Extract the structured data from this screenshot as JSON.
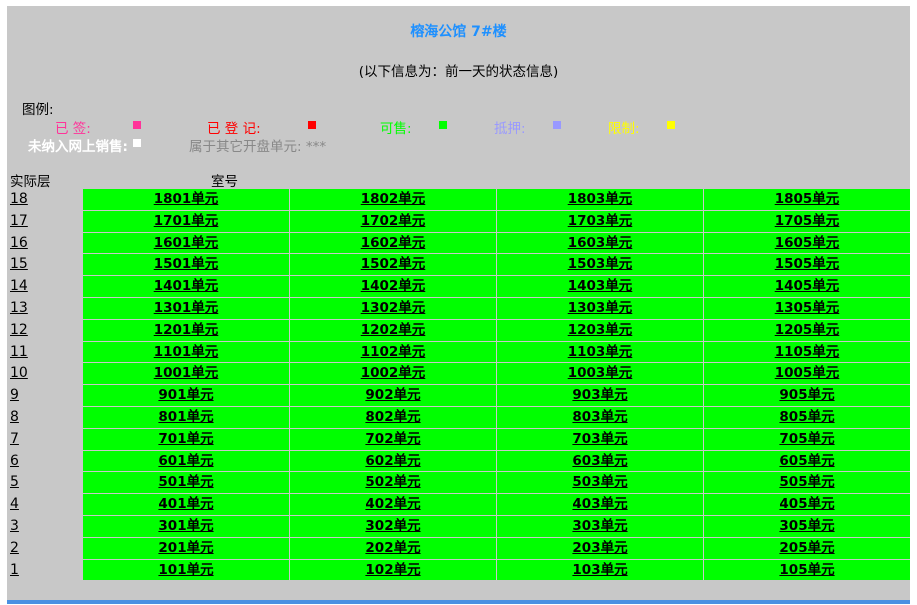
{
  "header": {
    "title": "榕海公馆  7#楼",
    "subtitle": "(以下信息为：前一天的状态信息)"
  },
  "legend": {
    "label": "图例:",
    "items": [
      {
        "label": "已  签:",
        "color": "#ff3399"
      },
      {
        "label": "已  登  记:",
        "color": "#ff0000"
      },
      {
        "label": "可售:",
        "color": "#00ff00"
      },
      {
        "label": "抵押:",
        "color": "#9999ff"
      },
      {
        "label": "限制:",
        "color": "#ffff00"
      },
      {
        "label": "未纳入网上销售:",
        "color": "#ffffff"
      }
    ],
    "other_units": "属于其它开盘单元: ***"
  },
  "table": {
    "floor_header": "实际层",
    "room_header": "室号",
    "rows": [
      {
        "floor": "18",
        "units": [
          "1801单元",
          "1802单元",
          "1803单元",
          "1805单元"
        ]
      },
      {
        "floor": "17",
        "units": [
          "1701单元",
          "1702单元",
          "1703单元",
          "1705单元"
        ]
      },
      {
        "floor": "16",
        "units": [
          "1601单元",
          "1602单元",
          "1603单元",
          "1605单元"
        ]
      },
      {
        "floor": "15",
        "units": [
          "1501单元",
          "1502单元",
          "1503单元",
          "1505单元"
        ]
      },
      {
        "floor": "14",
        "units": [
          "1401单元",
          "1402单元",
          "1403单元",
          "1405单元"
        ]
      },
      {
        "floor": "13",
        "units": [
          "1301单元",
          "1302单元",
          "1303单元",
          "1305单元"
        ]
      },
      {
        "floor": "12",
        "units": [
          "1201单元",
          "1202单元",
          "1203单元",
          "1205单元"
        ]
      },
      {
        "floor": "11",
        "units": [
          "1101单元",
          "1102单元",
          "1103单元",
          "1105单元"
        ]
      },
      {
        "floor": "10",
        "units": [
          "1001单元",
          "1002单元",
          "1003单元",
          "1005单元"
        ]
      },
      {
        "floor": "9",
        "units": [
          "901单元",
          "902单元",
          "903单元",
          "905单元"
        ]
      },
      {
        "floor": "8",
        "units": [
          "801单元",
          "802单元",
          "803单元",
          "805单元"
        ]
      },
      {
        "floor": "7",
        "units": [
          "701单元",
          "702单元",
          "703单元",
          "705单元"
        ]
      },
      {
        "floor": "6",
        "units": [
          "601单元",
          "602单元",
          "603单元",
          "605单元"
        ]
      },
      {
        "floor": "5",
        "units": [
          "501单元",
          "502单元",
          "503单元",
          "505单元"
        ]
      },
      {
        "floor": "4",
        "units": [
          "401单元",
          "402单元",
          "403单元",
          "405单元"
        ]
      },
      {
        "floor": "3",
        "units": [
          "301单元",
          "302单元",
          "303单元",
          "305单元"
        ]
      },
      {
        "floor": "2",
        "units": [
          "201单元",
          "202单元",
          "203单元",
          "205单元"
        ]
      },
      {
        "floor": "1",
        "units": [
          "101单元",
          "102单元",
          "103单元",
          "105单元"
        ]
      }
    ]
  }
}
